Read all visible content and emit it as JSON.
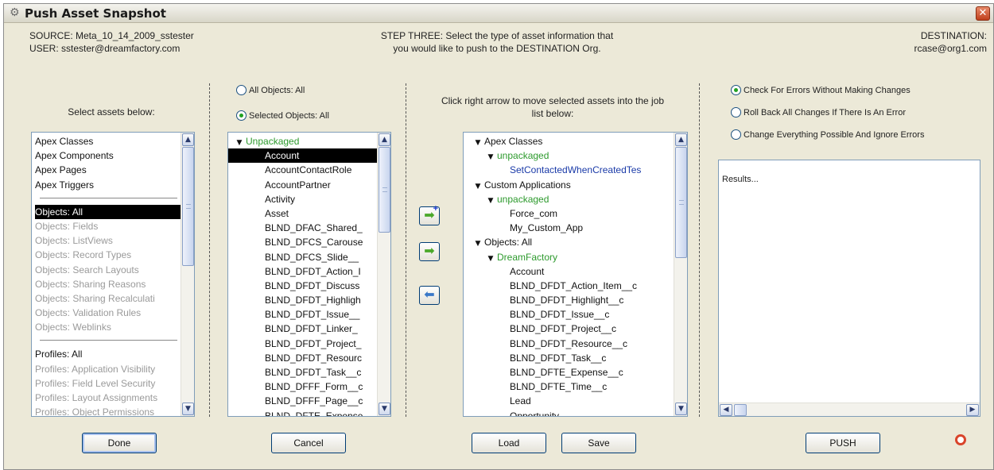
{
  "window": {
    "title": "Push Asset Snapshot",
    "close_glyph": "✕"
  },
  "header": {
    "source": "SOURCE: Meta_10_14_2009_sstester",
    "user": "USER: sstester@dreamfactory.com",
    "step_line1": "STEP THREE: Select the type of asset information that",
    "step_line2": "you would like to push to the DESTINATION Org.",
    "destination_label": "DESTINATION:",
    "destination_value": "rcase@org1.com"
  },
  "col1": {
    "heading": "Select assets below:",
    "group1": [
      "Apex Classes",
      "Apex Components",
      "Apex Pages",
      "Apex Triggers"
    ],
    "group2": [
      {
        "label": "Objects: All",
        "state": "selected"
      },
      {
        "label": "Objects: Fields",
        "state": "dim"
      },
      {
        "label": "Objects: ListViews",
        "state": "dim"
      },
      {
        "label": "Objects: Record Types",
        "state": "dim"
      },
      {
        "label": "Objects: Search Layouts",
        "state": "dim"
      },
      {
        "label": "Objects: Sharing Reasons",
        "state": "dim"
      },
      {
        "label": "Objects: Sharing Recalculati",
        "state": "dim"
      },
      {
        "label": "Objects: Validation Rules",
        "state": "dim"
      },
      {
        "label": "Objects: Weblinks",
        "state": "dim"
      }
    ],
    "group3": [
      {
        "label": "Profiles: All",
        "state": "normal"
      },
      {
        "label": "Profiles: Application Visibility",
        "state": "dim"
      },
      {
        "label": "Profiles: Field Level Security",
        "state": "dim"
      },
      {
        "label": "Profiles: Layout Assignments",
        "state": "dim"
      },
      {
        "label": "Profiles: Object Permissions",
        "state": "dim"
      }
    ],
    "done_label": "Done"
  },
  "col2": {
    "radio_all": "All Objects: All",
    "radio_selected": "Selected Objects: All",
    "tree_root": "Unpackaged",
    "items": [
      "Account",
      "AccountContactRole",
      "AccountPartner",
      "Activity",
      "Asset",
      "BLND_DFAC_Shared_",
      "BLND_DFCS_Carouse",
      "BLND_DFCS_Slide__",
      "BLND_DFDT_Action_I",
      "BLND_DFDT_Discuss",
      "BLND_DFDT_Highligh",
      "BLND_DFDT_Issue__",
      "BLND_DFDT_Linker_",
      "BLND_DFDT_Project_",
      "BLND_DFDT_Resourc",
      "BLND_DFDT_Task__c",
      "BLND_DFFF_Form__c",
      "BLND_DFFF_Page__c",
      "BLND_DFTE_Expense"
    ],
    "cancel_label": "Cancel"
  },
  "col3": {
    "instruction_line1": "Click right arrow to move selected assets into the job",
    "instruction_line2": "list below:",
    "add_all_glyph": "➡",
    "add_glyph": "➡",
    "remove_glyph": "⬅",
    "tree": [
      {
        "label": "Apex Classes",
        "level": 0,
        "expander": true,
        "color": "normal"
      },
      {
        "label": "unpackaged",
        "level": 1,
        "expander": true,
        "color": "green"
      },
      {
        "label": "SetContactedWhenCreatedTes",
        "level": 2,
        "expander": false,
        "color": "blue"
      },
      {
        "label": "Custom Applications",
        "level": 0,
        "expander": true,
        "color": "normal"
      },
      {
        "label": "unpackaged",
        "level": 1,
        "expander": true,
        "color": "green"
      },
      {
        "label": "Force_com",
        "level": 2,
        "expander": false,
        "color": "normal"
      },
      {
        "label": "My_Custom_App",
        "level": 2,
        "expander": false,
        "color": "normal"
      },
      {
        "label": "Objects: All",
        "level": 0,
        "expander": true,
        "color": "normal"
      },
      {
        "label": "DreamFactory",
        "level": 1,
        "expander": true,
        "color": "green"
      },
      {
        "label": "Account",
        "level": 2,
        "expander": false,
        "color": "normal"
      },
      {
        "label": "BLND_DFDT_Action_Item__c",
        "level": 2,
        "expander": false,
        "color": "normal"
      },
      {
        "label": "BLND_DFDT_Highlight__c",
        "level": 2,
        "expander": false,
        "color": "normal"
      },
      {
        "label": "BLND_DFDT_Issue__c",
        "level": 2,
        "expander": false,
        "color": "normal"
      },
      {
        "label": "BLND_DFDT_Project__c",
        "level": 2,
        "expander": false,
        "color": "normal"
      },
      {
        "label": "BLND_DFDT_Resource__c",
        "level": 2,
        "expander": false,
        "color": "normal"
      },
      {
        "label": "BLND_DFDT_Task__c",
        "level": 2,
        "expander": false,
        "color": "normal"
      },
      {
        "label": "BLND_DFTE_Expense__c",
        "level": 2,
        "expander": false,
        "color": "normal"
      },
      {
        "label": "BLND_DFTE_Time__c",
        "level": 2,
        "expander": false,
        "color": "normal"
      },
      {
        "label": "Lead",
        "level": 2,
        "expander": false,
        "color": "normal"
      },
      {
        "label": "Opportunity",
        "level": 2,
        "expander": false,
        "color": "normal"
      }
    ],
    "load_label": "Load",
    "save_label": "Save"
  },
  "col4": {
    "radio_check": "Check For Errors Without Making Changes",
    "radio_rollback": "Roll Back All Changes If There Is An Error",
    "radio_change": "Change Everything Possible And Ignore Errors",
    "results_text": "Results...",
    "push_label": "PUSH"
  },
  "colors": {
    "accent_green": "#2d9a2d",
    "link_blue": "#1a3aa8",
    "selection": "#000000",
    "window_bg": "#ece9d8"
  },
  "icons": {
    "title": "gear-icon",
    "help": "lifebuoy-icon"
  }
}
